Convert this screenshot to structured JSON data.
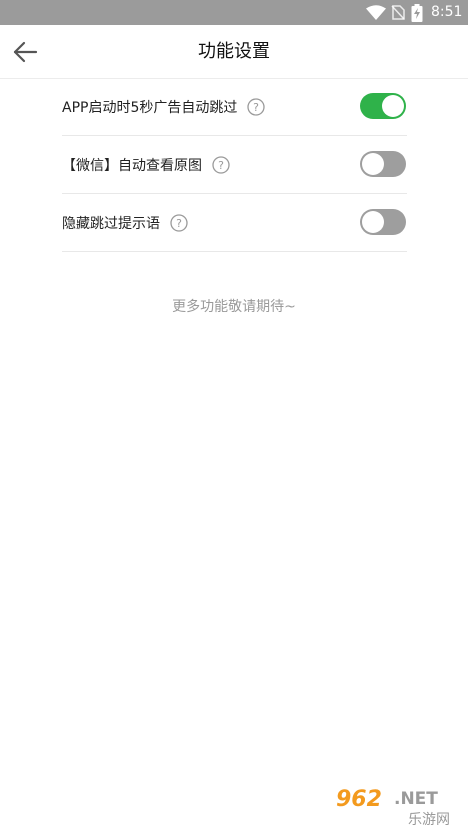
{
  "status_bar": {
    "time": "8:51",
    "icons": [
      "wifi-icon",
      "sim-no-signal-icon",
      "battery-charging-icon"
    ],
    "background": "#9b9b9b"
  },
  "header": {
    "title": "功能设置",
    "back_icon": "arrow-left-icon"
  },
  "settings": [
    {
      "label": "APP启动时5秒广告自动跳过",
      "help_icon": "question-circle-icon",
      "enabled": true
    },
    {
      "label": "【微信】自动查看原图",
      "help_icon": "question-circle-icon",
      "enabled": false
    },
    {
      "label": "隐藏跳过提示语",
      "help_icon": "question-circle-icon",
      "enabled": false
    }
  ],
  "footer_note": "更多功能敬请期待~",
  "colors": {
    "toggle_on": "#2fb24a",
    "toggle_off": "#9e9e9e",
    "muted_text": "#9a9a9a"
  },
  "watermark": {
    "text_top": "962.NET",
    "text_bottom": "乐游网"
  }
}
